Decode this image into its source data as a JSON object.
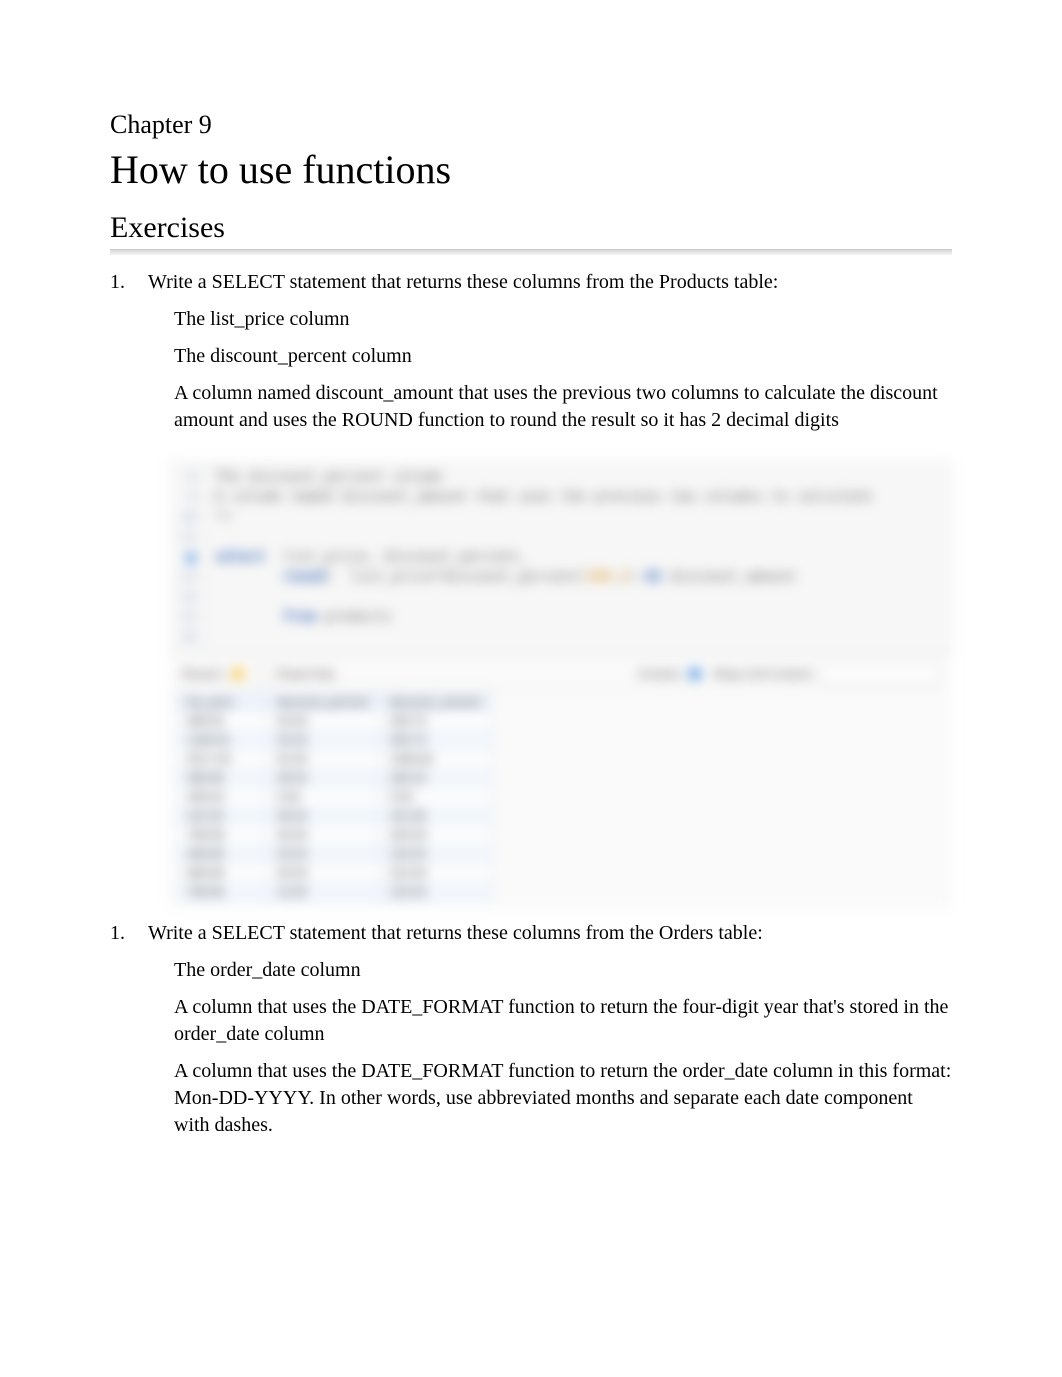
{
  "chapter_label": "Chapter 9",
  "chapter_title": "How to use functions",
  "section_title": "Exercises",
  "ex1": {
    "num": "1.",
    "prompt": "Write a SELECT statement that returns these columns from the Products table:",
    "items": [
      "The list_price column",
      "The discount_percent column",
      "A column named discount_amount that uses the previous two columns to calculate the discount amount and uses the ROUND function to round the result so it has 2 decimal digits"
    ]
  },
  "code": {
    "lines": [
      {
        "n": "8",
        "txt": "The discount_percent column"
      },
      {
        "n": "9",
        "txt": "A column named discount_amount that uses the previous two columns to calculate"
      },
      {
        "n": "10",
        "txt": "*/"
      },
      {
        "n": "11",
        "txt": ""
      },
      {
        "n": "12",
        "dot": true,
        "txt": "select  list_price, discount_percent,"
      },
      {
        "n": "13",
        "txt": "        round(  list_price*discount_percent/100,2) AS discount_amount"
      },
      {
        "n": "14",
        "txt": ""
      },
      {
        "n": "15",
        "txt": "        from products"
      },
      {
        "n": "16",
        "txt": ""
      }
    ]
  },
  "toolbar": {
    "result": "Result 1",
    "readonly": "Read Only",
    "content": "Content:",
    "wrap": "Wrap Cell Content:"
  },
  "table": {
    "headers": [
      "list_price",
      "discount_percent",
      "discount_amount"
    ],
    "rows": [
      [
        "699.00",
        "30.00",
        "209.70"
      ],
      [
        "1199.00",
        "30.00",
        "359.70"
      ],
      [
        "2517.00",
        "52.00",
        "1308.84"
      ],
      [
        "489.99",
        "38.00",
        "186.20"
      ],
      [
        "299.00",
        "0.00",
        "0.00"
      ],
      [
        "415.00",
        "39.00",
        "161.85"
      ],
      [
        "799.99",
        "30.00",
        "240.00"
      ],
      [
        "499.99",
        "25.00",
        "125.00"
      ],
      [
        "699.99",
        "30.00",
        "210.00"
      ],
      [
        "799.99",
        "15.00",
        "120.00"
      ]
    ]
  },
  "ex2": {
    "num": "1.",
    "prompt": "Write a SELECT statement that returns these columns from the Orders table:",
    "items": [
      "The order_date column",
      "A column that uses the DATE_FORMAT function to return the four-digit year that's stored in the order_date column",
      "A column that uses the DATE_FORMAT function to return the order_date column in this format: Mon-DD-YYYY. In other words, use abbreviated months and separate each date component with dashes."
    ]
  }
}
